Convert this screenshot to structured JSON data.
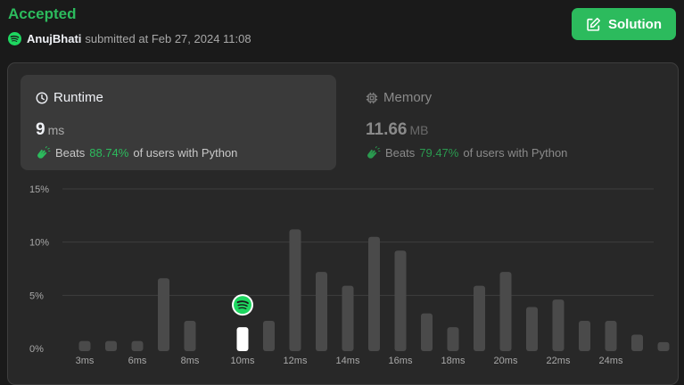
{
  "header": {
    "status": "Accepted",
    "username": "AnujBhati",
    "submitted_text": "submitted at Feb 27, 2024 11:08",
    "solution_button": "Solution"
  },
  "runtime": {
    "label": "Runtime",
    "value": "9",
    "unit": "ms",
    "beats_prefix": "Beats",
    "beats_pct": "88.74%",
    "beats_suffix": "of users with Python"
  },
  "memory": {
    "label": "Memory",
    "value": "11.66",
    "unit": "MB",
    "beats_prefix": "Beats",
    "beats_pct": "79.47%",
    "beats_suffix": "of users with Python"
  },
  "colors": {
    "accent": "#2cbb5d",
    "bar": "#4a4a4a",
    "highlight_bar": "#ffffff"
  },
  "icons": {
    "user_avatar": "spotify-avatar-icon",
    "solution": "edit-icon",
    "runtime": "clock-icon",
    "memory": "chip-icon",
    "beats": "clap-icon"
  },
  "chart_data": {
    "type": "bar",
    "ylim": [
      0,
      15
    ],
    "ytick_labels": [
      "0%",
      "5%",
      "10%",
      "15%"
    ],
    "ytick_values": [
      0,
      5,
      10,
      15
    ],
    "x": [
      3,
      4,
      5,
      6,
      7,
      8,
      9,
      10,
      11,
      12,
      13,
      14,
      15,
      16,
      17,
      18,
      19,
      20,
      21,
      22,
      23,
      24,
      25
    ],
    "values": [
      0.7,
      0.7,
      0.7,
      6.6,
      2.6,
      0,
      2.0,
      2.6,
      11.2,
      7.2,
      5.9,
      10.5,
      9.2,
      3.3,
      2.0,
      5.9,
      7.2,
      3.9,
      4.6,
      2.6,
      2.6,
      1.3,
      0.6
    ],
    "highlight_x": 9,
    "xtick_labels": [
      "3ms",
      "6ms",
      "8ms",
      "10ms",
      "12ms",
      "14ms",
      "16ms",
      "18ms",
      "20ms",
      "22ms",
      "24ms"
    ],
    "xtick_values": [
      3,
      5,
      7,
      9,
      11,
      13,
      15,
      17,
      19,
      21,
      23
    ],
    "grid": true
  }
}
